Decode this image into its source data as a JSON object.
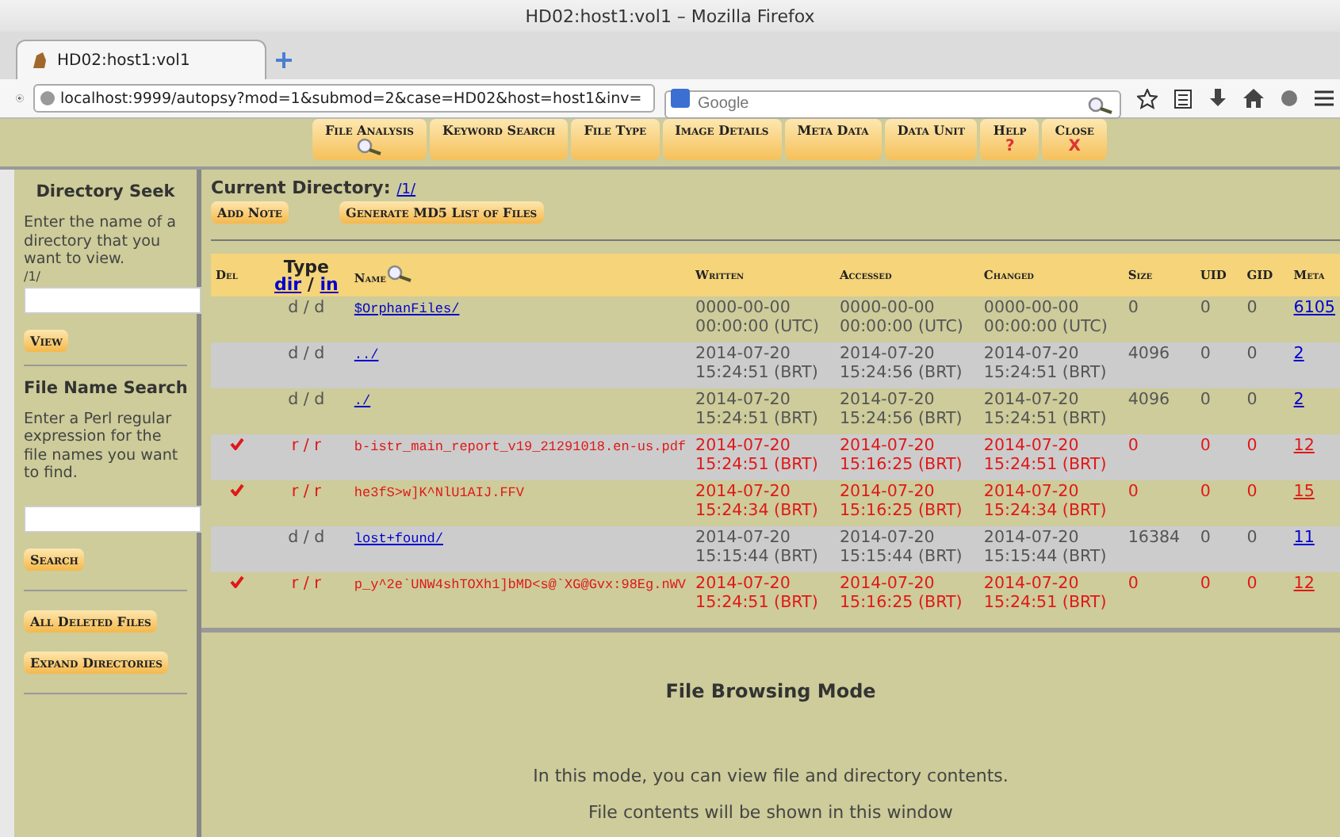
{
  "window": {
    "title": "HD02:host1:vol1 – Mozilla Firefox"
  },
  "tabs": [
    {
      "label": "HD02:host1:vol1",
      "selected": true
    }
  ],
  "address_bar": {
    "value": "localhost:9999/autopsy?mod=1&submod=2&case=HD02&host=host1&inv="
  },
  "search": {
    "placeholder": "Google"
  },
  "nav": [
    {
      "label": "File Analysis",
      "selected": true
    },
    {
      "label": "Keyword Search",
      "selected": false
    },
    {
      "label": "File Type",
      "selected": false
    },
    {
      "label": "Image Details",
      "selected": false
    },
    {
      "label": "Meta Data",
      "selected": false
    },
    {
      "label": "Data Unit",
      "selected": false
    },
    {
      "label": "Help",
      "symbol": "?",
      "selected": false
    },
    {
      "label": "Close",
      "symbol": "X",
      "selected": false
    }
  ],
  "sidebar": {
    "directory_seek": {
      "title": "Directory Seek",
      "text": "Enter the name of a directory that you want to view.",
      "path": "/1/",
      "button": "View"
    },
    "file_name_search": {
      "title": "File Name Search",
      "text": "Enter a Perl regular expression for the file names you want to find.",
      "button": "Search"
    },
    "buttons": [
      "All Deleted Files",
      "Expand Directories"
    ]
  },
  "current_directory": {
    "label": "Current Directory:",
    "path": "/1/"
  },
  "actions": [
    "Add Note",
    "Generate MD5 List of Files"
  ],
  "table": {
    "columns": {
      "del": "Del",
      "type": "Type",
      "type_dir": "dir",
      "type_sep": "/",
      "type_in": "in",
      "name": "Name",
      "written": "Written",
      "accessed": "Accessed",
      "changed": "Changed",
      "size": "Size",
      "uid": "UID",
      "gid": "GID",
      "meta": "Meta"
    },
    "rows": [
      {
        "deleted": false,
        "type": "d / d",
        "name": "$OrphanFiles/",
        "written": "0000-00-00 00:00:00 (UTC)",
        "accessed": "0000-00-00 00:00:00 (UTC)",
        "changed": "0000-00-00 00:00:00 (UTC)",
        "size": "0",
        "uid": "0",
        "gid": "0",
        "meta": "6105"
      },
      {
        "deleted": false,
        "type": "d / d",
        "name": "../",
        "written": "2014-07-20 15:24:51 (BRT)",
        "accessed": "2014-07-20 15:24:56 (BRT)",
        "changed": "2014-07-20 15:24:51 (BRT)",
        "size": "4096",
        "uid": "0",
        "gid": "0",
        "meta": "2"
      },
      {
        "deleted": false,
        "type": "d / d",
        "name": "./",
        "written": "2014-07-20 15:24:51 (BRT)",
        "accessed": "2014-07-20 15:24:56 (BRT)",
        "changed": "2014-07-20 15:24:51 (BRT)",
        "size": "4096",
        "uid": "0",
        "gid": "0",
        "meta": "2"
      },
      {
        "deleted": true,
        "type": "r / r",
        "name": "b-istr_main_report_v19_21291018.en-us.pdf",
        "written": "2014-07-20 15:24:51 (BRT)",
        "accessed": "2014-07-20 15:16:25 (BRT)",
        "changed": "2014-07-20 15:24:51 (BRT)",
        "size": "0",
        "uid": "0",
        "gid": "0",
        "meta": "12"
      },
      {
        "deleted": true,
        "type": "r / r",
        "name": "he3fS>w]K^NlU1AIJ.FFV",
        "written": "2014-07-20 15:24:34 (BRT)",
        "accessed": "2014-07-20 15:16:25 (BRT)",
        "changed": "2014-07-20 15:24:34 (BRT)",
        "size": "0",
        "uid": "0",
        "gid": "0",
        "meta": "15"
      },
      {
        "deleted": false,
        "type": "d / d",
        "name": "lost+found/",
        "written": "2014-07-20 15:15:44 (BRT)",
        "accessed": "2014-07-20 15:15:44 (BRT)",
        "changed": "2014-07-20 15:15:44 (BRT)",
        "size": "16384",
        "uid": "0",
        "gid": "0",
        "meta": "11"
      },
      {
        "deleted": true,
        "type": "r / r",
        "name": "p_y^2e`UNW4shTOXh1]bMD<s@`XG@Gvx:98Eg.nWV",
        "written": "2014-07-20 15:24:51 (BRT)",
        "accessed": "2014-07-20 15:16:25 (BRT)",
        "changed": "2014-07-20 15:24:51 (BRT)",
        "size": "0",
        "uid": "0",
        "gid": "0",
        "meta": "12"
      }
    ]
  },
  "info": {
    "title": "File Browsing Mode",
    "lines": [
      "In this mode, you can view file and directory contents.",
      "File contents will be shown in this window"
    ]
  }
}
